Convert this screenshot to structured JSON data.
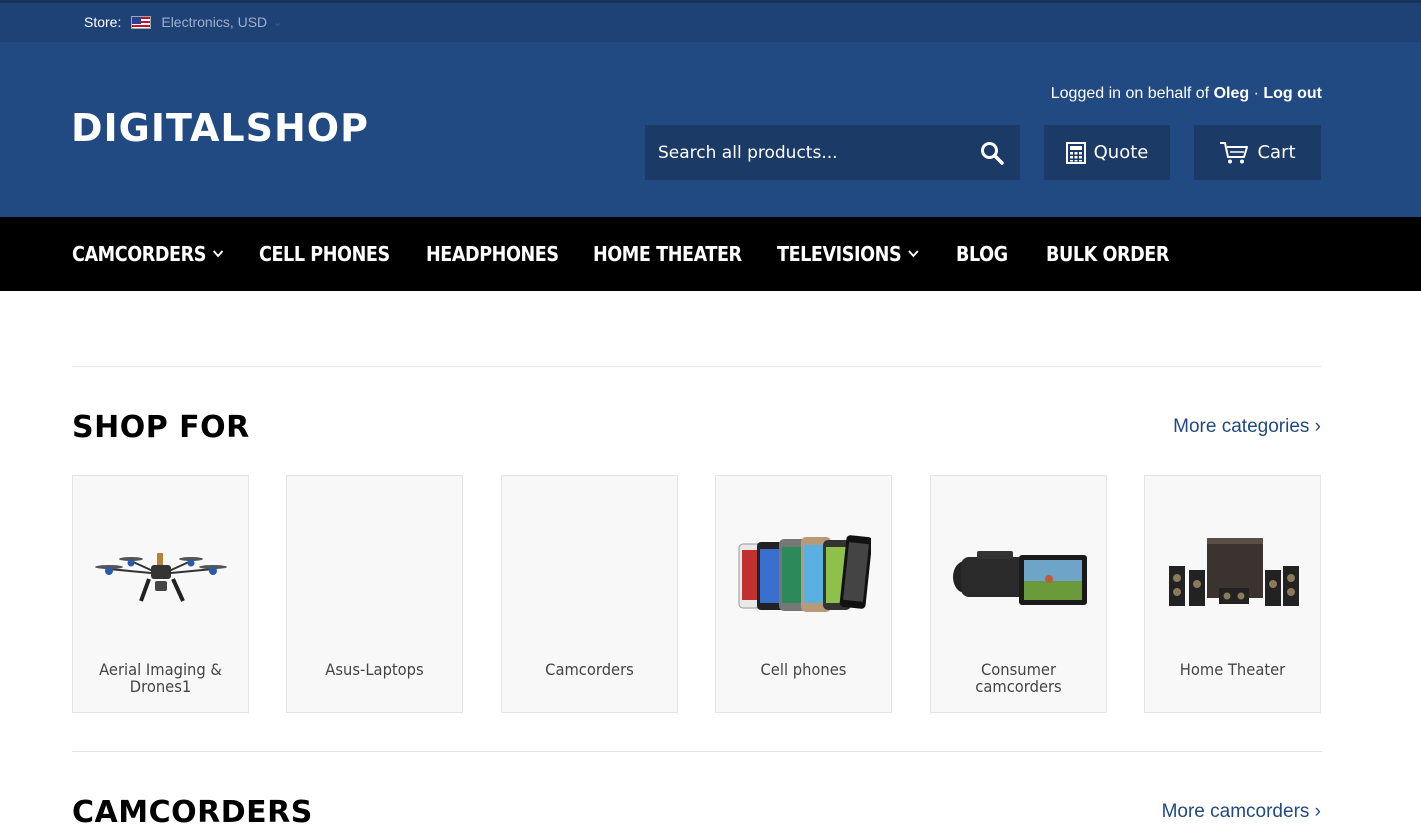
{
  "topbar": {
    "store_label": "Store:",
    "store_value": "Electronics, USD"
  },
  "header": {
    "logo_text": "DIGITALSHOP",
    "logged_prefix": "Logged in on behalf of ",
    "user_name": "Oleg",
    "separator": "·",
    "logout_label": "Log out",
    "search_placeholder": "Search all products...",
    "quote_label": "Quote",
    "cart_label": "Cart"
  },
  "nav": [
    {
      "label": "CAMCORDERS",
      "dropdown": true
    },
    {
      "label": "CELL PHONES",
      "dropdown": false
    },
    {
      "label": "HEADPHONES",
      "dropdown": false
    },
    {
      "label": "HOME THEATER",
      "dropdown": false
    },
    {
      "label": "TELEVISIONS",
      "dropdown": true
    },
    {
      "label": "BLOG",
      "dropdown": false
    },
    {
      "label": "BULK ORDER",
      "dropdown": false
    }
  ],
  "shop_for": {
    "title": "SHOP FOR",
    "more_label": "More categories ›",
    "categories": [
      {
        "label": "Aerial Imaging & Drones1",
        "image": "drone-image"
      },
      {
        "label": "Asus-Laptops",
        "image": ""
      },
      {
        "label": "Camcorders",
        "image": ""
      },
      {
        "label": "Cell phones",
        "image": "phones-image"
      },
      {
        "label": "Consumer camcorders",
        "image": "camcorder-image"
      },
      {
        "label": "Home Theater",
        "image": "speakers-image"
      }
    ]
  },
  "camcorders": {
    "title": "CAMCORDERS",
    "more_label": "More camcorders ›"
  },
  "colors": {
    "topbar": "#1e4276",
    "header": "#224a82",
    "nav": "#000000",
    "link": "#224a82"
  }
}
